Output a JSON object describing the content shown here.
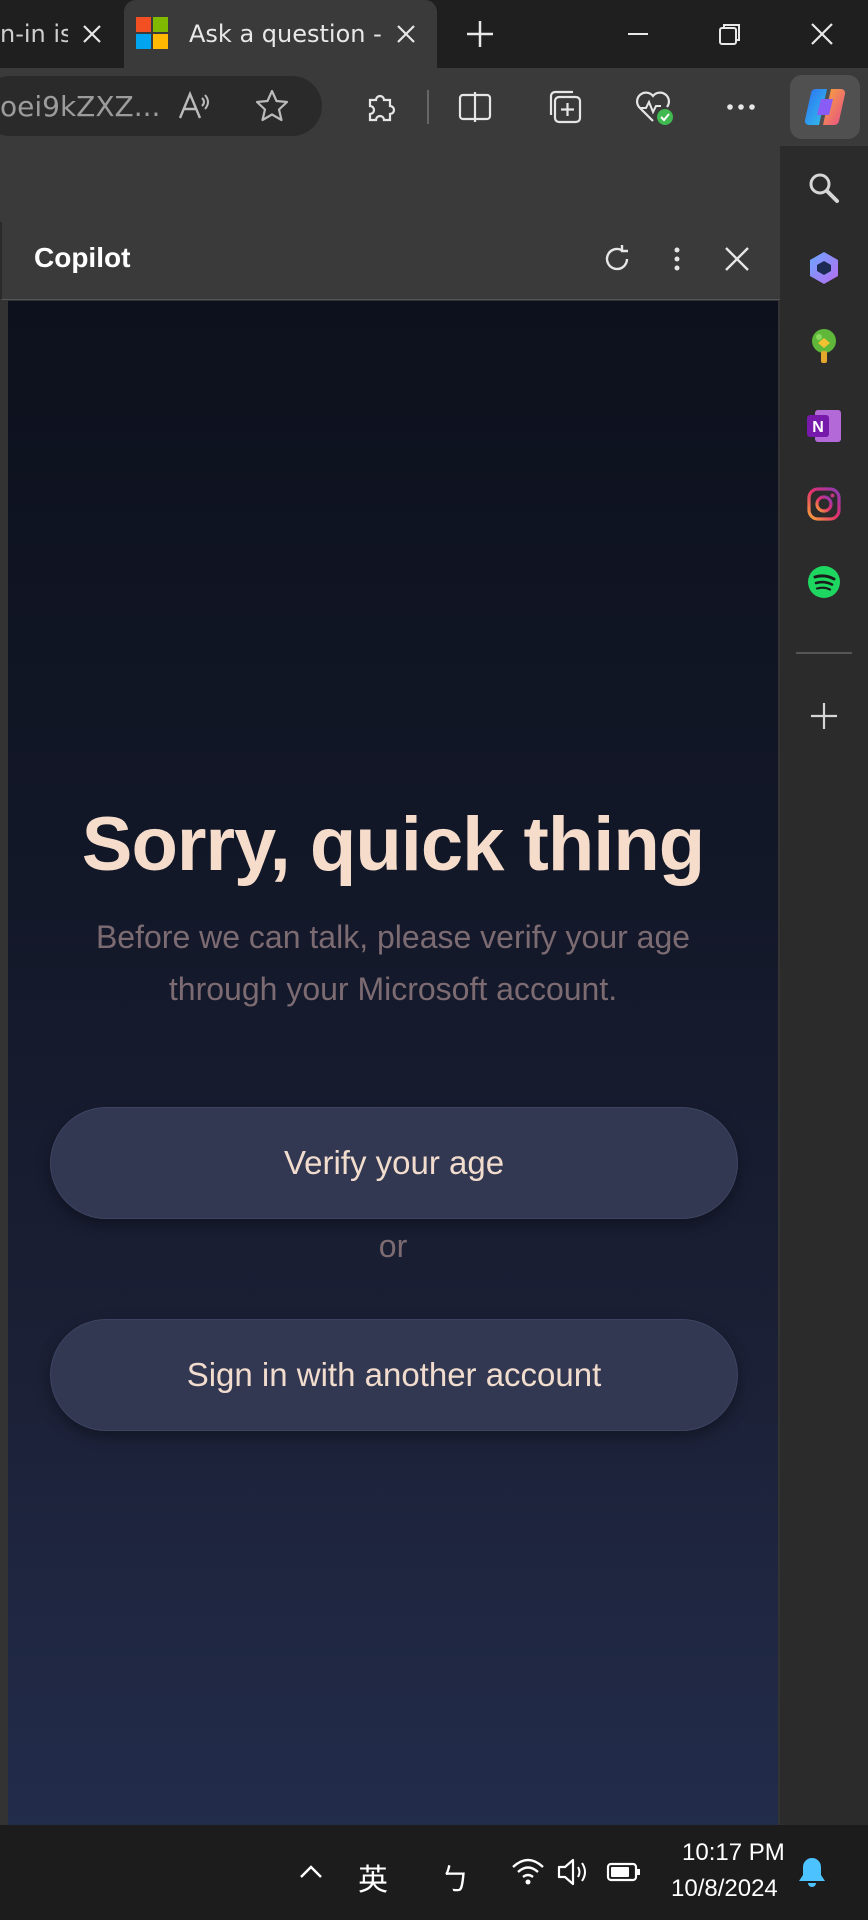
{
  "browser": {
    "tabs": [
      {
        "label": "n-in iss"
      },
      {
        "label": "Ask a question - M"
      }
    ],
    "address": {
      "text": "oei9kZXZ..."
    }
  },
  "copilot_pane": {
    "title": "Copilot",
    "heading": "Sorry, quick thing",
    "subtext_line1": "Before we can talk, please verify your age",
    "subtext_line2": "through your Microsoft account.",
    "verify_button_label": "Verify your age",
    "or_label": "or",
    "signin_button_label": "Sign in with another account"
  },
  "taskbar": {
    "ime_label": "英",
    "ime_mode": "ㄅ",
    "time": "10:17 PM",
    "date": "10/8/2024"
  },
  "colors": {
    "heading": "#f5dccb",
    "subtext": "#7d6b72",
    "button_bg": "#323852",
    "pane_gradient_top": "#0d111d",
    "pane_gradient_bottom": "#222c4b"
  }
}
